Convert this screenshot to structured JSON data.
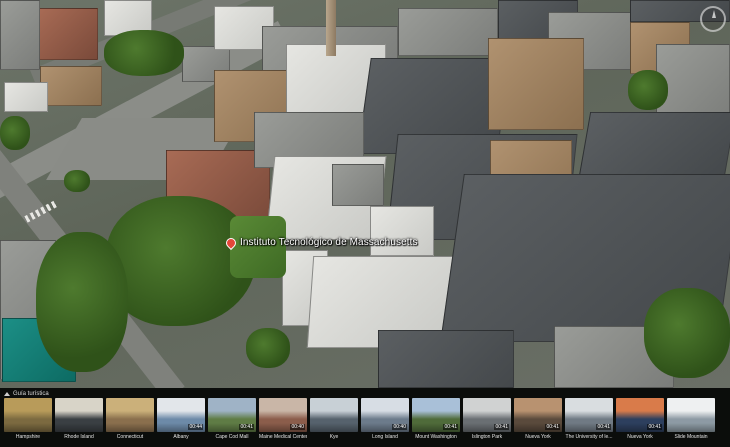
{
  "map": {
    "place_label": "Instituto Tecnológico de Massachusetts",
    "compass_label": "compass"
  },
  "tour": {
    "title": "Guía turística",
    "items": [
      {
        "name": "Hampshire",
        "duration": "",
        "palette": [
          "#7c6a40",
          "#b89b5a"
        ]
      },
      {
        "name": "Rhode Island",
        "duration": "",
        "palette": [
          "#3a3f43",
          "#d8d4c8"
        ]
      },
      {
        "name": "Connecticut",
        "duration": "",
        "palette": [
          "#8a6f4d",
          "#cbb07a"
        ]
      },
      {
        "name": "Albany",
        "duration": "00:44",
        "palette": [
          "#6d8aa8",
          "#e2e6ea"
        ]
      },
      {
        "name": "Cape Cod Mall",
        "duration": "00:41",
        "palette": [
          "#5f7c45",
          "#9fb3c6"
        ]
      },
      {
        "name": "Maine Medical Center",
        "duration": "00:40",
        "palette": [
          "#8b5d4b",
          "#c9b6a7"
        ]
      },
      {
        "name": "Kye",
        "duration": "",
        "palette": [
          "#56626d",
          "#c8d0d6"
        ]
      },
      {
        "name": "Long Island",
        "duration": "00:40",
        "palette": [
          "#6c7b8b",
          "#d7dde4"
        ]
      },
      {
        "name": "Mount Washington",
        "duration": "00:41",
        "palette": [
          "#4f6b3a",
          "#a9c0d8"
        ]
      },
      {
        "name": "Islington Park",
        "duration": "00:41",
        "palette": [
          "#6a6f73",
          "#d0d2d2"
        ]
      },
      {
        "name": "Nueva York",
        "duration": "00:41",
        "palette": [
          "#5a4a3c",
          "#b89270"
        ]
      },
      {
        "name": "The University of le...",
        "duration": "00:41",
        "palette": [
          "#707a84",
          "#d9dde0"
        ]
      },
      {
        "name": "Nueva York",
        "duration": "00:41",
        "palette": [
          "#2d3f5e",
          "#d97b4a"
        ]
      },
      {
        "name": "Slide Mountain",
        "duration": "",
        "palette": [
          "#8d9aa4",
          "#eef0f1"
        ]
      }
    ]
  }
}
